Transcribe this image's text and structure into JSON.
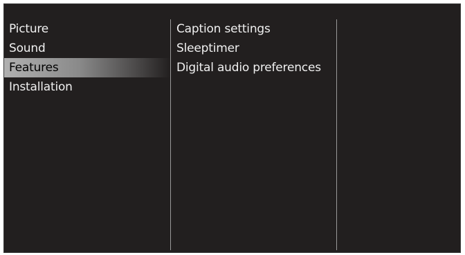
{
  "menu": {
    "main_items": [
      {
        "label": "Picture"
      },
      {
        "label": "Sound"
      },
      {
        "label": "Features"
      },
      {
        "label": "Installation"
      }
    ],
    "selected_main_index": 2,
    "sub_items": [
      {
        "label": "Caption settings"
      },
      {
        "label": "Sleeptimer"
      },
      {
        "label": "Digital audio preferences"
      }
    ]
  },
  "colors": {
    "background": "#221f1f",
    "text": "#f0f0f0",
    "highlight_text": "#000000",
    "divider": "#9a9a9a"
  }
}
